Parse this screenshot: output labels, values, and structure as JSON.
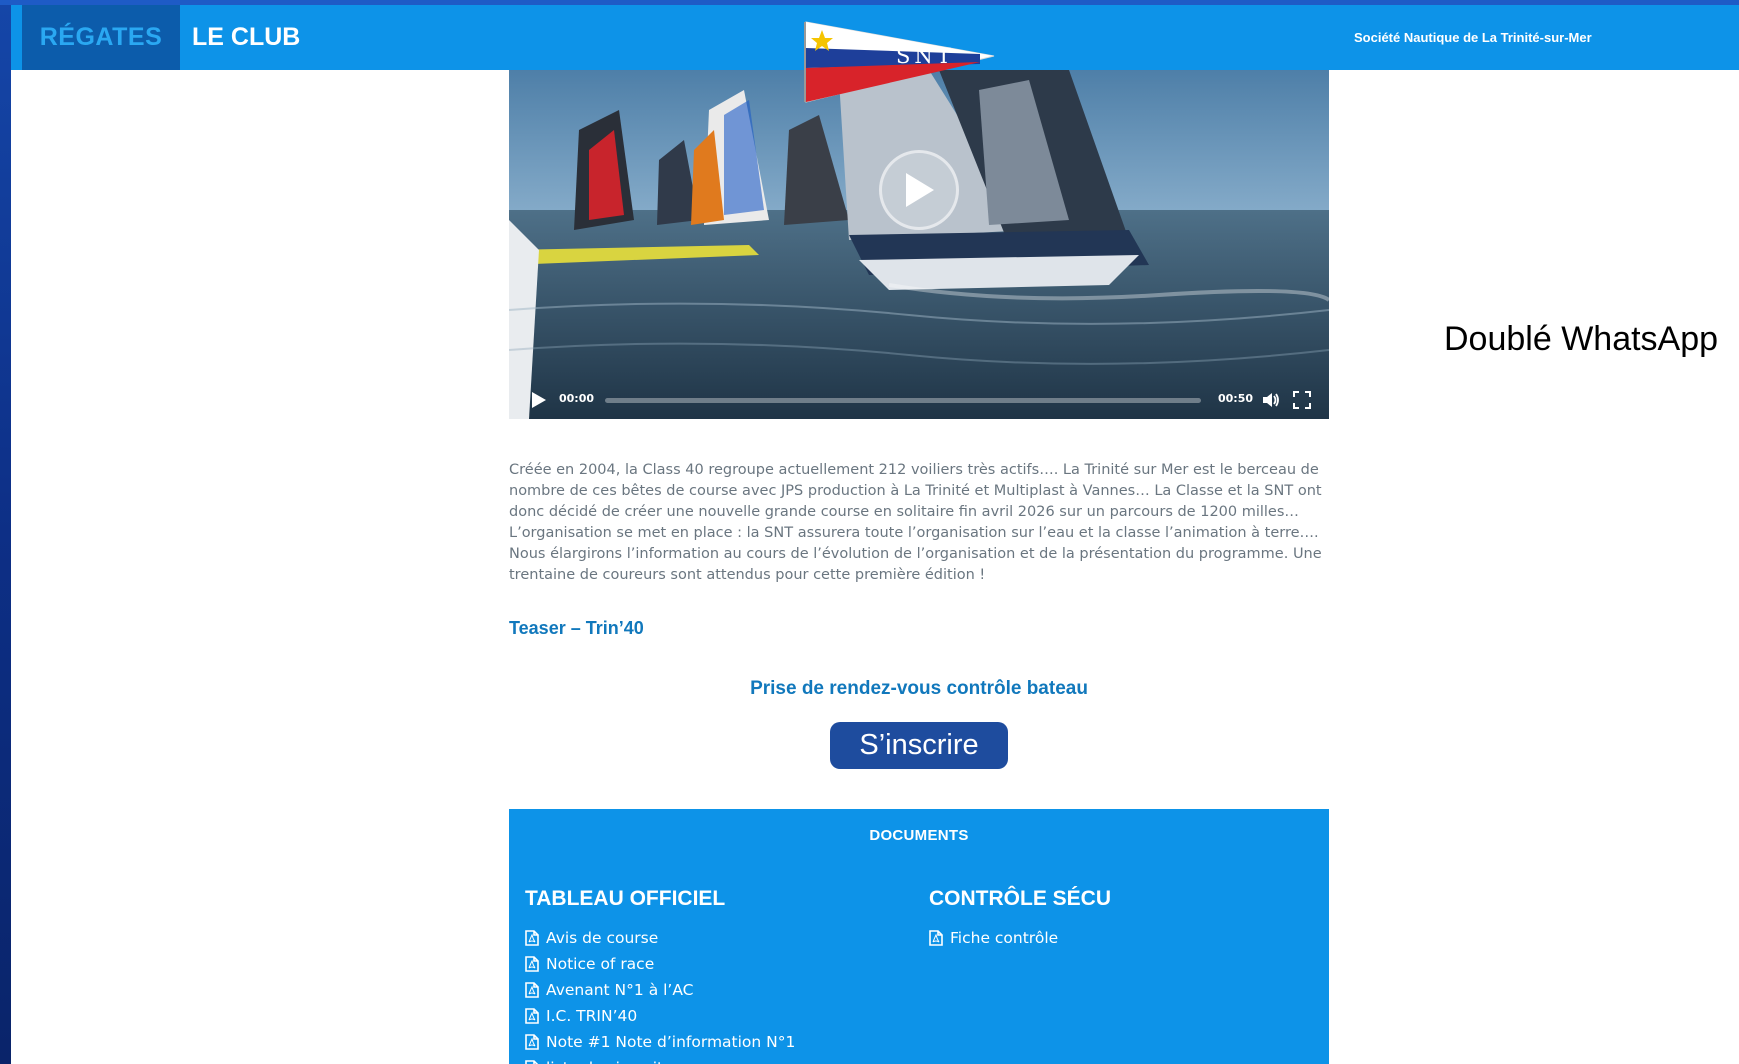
{
  "nav": {
    "regates": "RÉGATES",
    "le_club": "LE CLUB",
    "society": "Société Nautique de La Trinité-sur-Mer",
    "logo_text": "SNT"
  },
  "video": {
    "current_time": "00:00",
    "duration": "00:50",
    "progress": 0
  },
  "side_note": "Doublé WhatsApp",
  "description": "Créée en 2004, la Class 40 regroupe actuellement 212 voiliers très actifs…. La Trinité sur Mer est le berceau de nombre de ces bêtes de course avec JPS production à La Trinité et Multiplast à Vannes…  La Classe et la SNT ont donc décidé de créer une nouvelle grande course en solitaire fin avril 2026 sur un parcours de 1200 milles… L’organisation se met en place : la SNT assurera toute l’organisation sur l’eau et la classe l’animation à terre…. Nous élargirons l’information au cours de l’évolution de l’organisation et de la présentation du programme. Une trentaine de coureurs sont attendus pour cette première édition !",
  "teaser_link": "Teaser – Trin’40",
  "rdv_link": "Prise de rendez-vous contrôle bateau",
  "register_button": "S’inscrire",
  "documents": {
    "title": "DOCUMENTS",
    "col1": {
      "heading": "TABLEAU OFFICIEL",
      "items": [
        "Avis de course",
        "Notice of race",
        "Avenant N°1 à l’AC",
        "I.C. TRIN’40",
        "Note #1 Note d’information N°1",
        "liste des inscrits"
      ]
    },
    "col2": {
      "heading": "CONTRÔLE SÉCU",
      "items": [
        "Fiche contrôle"
      ]
    }
  },
  "colors": {
    "nav_blue": "#0d93e8",
    "nav_dark": "#0c5cab",
    "link_blue": "#1178bc",
    "button_blue": "#1e4c9e"
  }
}
